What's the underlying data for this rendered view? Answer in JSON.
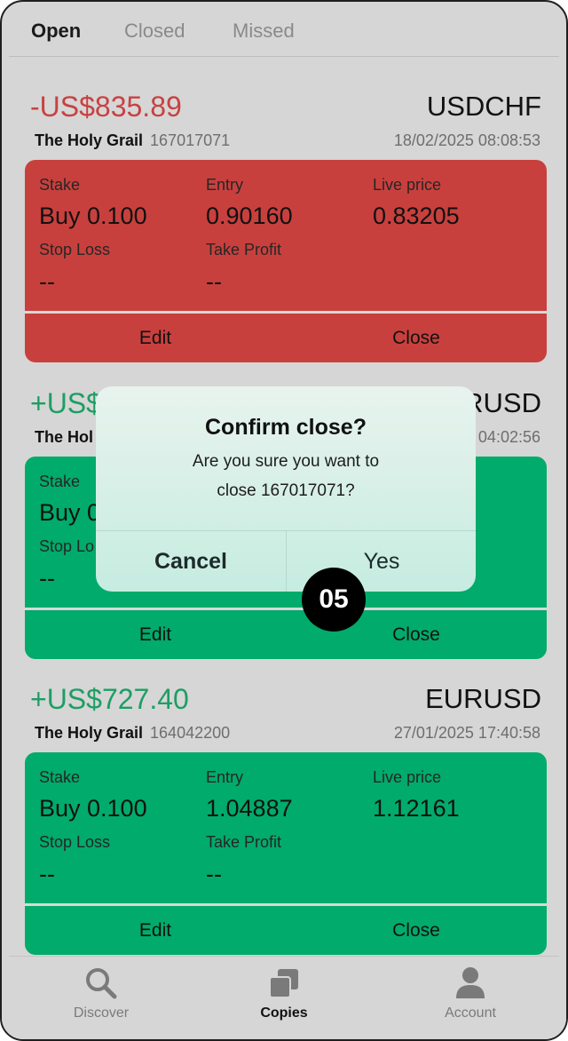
{
  "tabs": [
    {
      "label": "Open",
      "active": true
    },
    {
      "label": "Closed",
      "active": false
    },
    {
      "label": "Missed",
      "active": false
    }
  ],
  "trades": [
    {
      "pnl": "-US$835.89",
      "pnl_color": "#c94141",
      "symbol": "USDCHF",
      "strategy": "The Holy Grail",
      "trade_id": "167017071",
      "timestamp": "18/02/2025 08:08:53",
      "card_color": "#c8403d",
      "stake_label": "Stake",
      "stake": "Buy 0.100",
      "entry_label": "Entry",
      "entry": "0.90160",
      "live_label": "Live price",
      "live": "0.83205",
      "sl_label": "Stop Loss",
      "sl": "--",
      "tp_label": "Take Profit",
      "tp": "--",
      "edit_label": "Edit",
      "close_label": "Close"
    },
    {
      "pnl": "+US$",
      "pnl_color": "#1d9e64",
      "symbol": "RUSD",
      "strategy": "The Hol",
      "trade_id": "",
      "timestamp": "04:02:56",
      "card_color": "#00ab6b",
      "stake_label": "Stake",
      "stake": "Buy 0",
      "entry_label": "",
      "entry": "",
      "live_label": "",
      "live": "",
      "sl_label": "Stop Lo",
      "sl": "--",
      "tp_label": "",
      "tp": "",
      "edit_label": "Edit",
      "close_label": "Close"
    },
    {
      "pnl": "+US$727.40",
      "pnl_color": "#1d9e64",
      "symbol": "EURUSD",
      "strategy": "The Holy Grail",
      "trade_id": "164042200",
      "timestamp": "27/01/2025 17:40:58",
      "card_color": "#00ab6b",
      "stake_label": "Stake",
      "stake": "Buy 0.100",
      "entry_label": "Entry",
      "entry": "1.04887",
      "live_label": "Live price",
      "live": "1.12161",
      "sl_label": "Stop Loss",
      "sl": "--",
      "tp_label": "Take Profit",
      "tp": "--",
      "edit_label": "Edit",
      "close_label": "Close"
    }
  ],
  "dialog": {
    "title": "Confirm close?",
    "message_line1": "Are you sure you want to",
    "message_line2": "close 167017071?",
    "cancel_label": "Cancel",
    "yes_label": "Yes"
  },
  "step_badge": "05",
  "bottom_nav": [
    {
      "label": "Discover",
      "icon": "search-icon",
      "active": false
    },
    {
      "label": "Copies",
      "icon": "copies-icon",
      "active": true
    },
    {
      "label": "Account",
      "icon": "person-icon",
      "active": false
    }
  ],
  "colors": {
    "negative": "#c94141",
    "positive": "#1d9e64",
    "card_red": "#c8403d",
    "card_green": "#00ab6b",
    "background": "#d6d6d6"
  }
}
